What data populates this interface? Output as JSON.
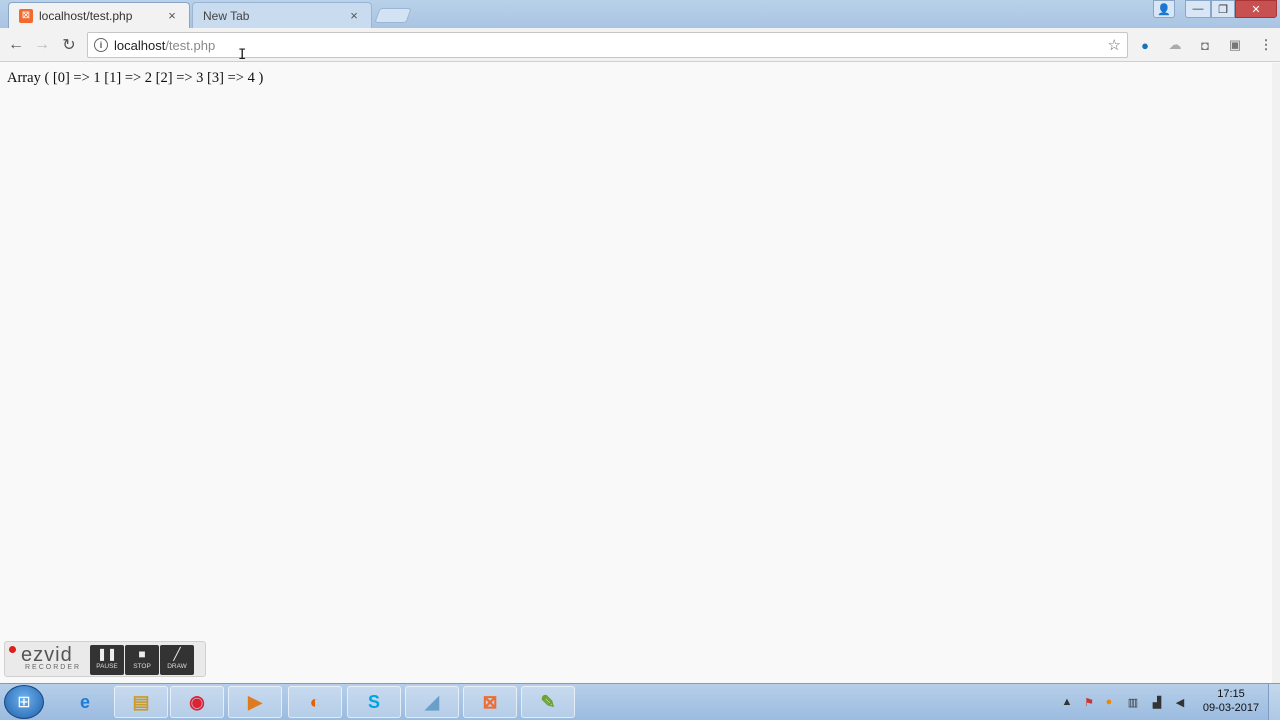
{
  "browser": {
    "tabs": [
      {
        "label": "localhost/test.php",
        "favicon": "xampp-icon",
        "active": true
      },
      {
        "label": "New Tab",
        "favicon": "",
        "active": false
      }
    ],
    "tab_close_glyph": "×",
    "address": {
      "host": "localhost",
      "path": "/test.php"
    },
    "nav": {
      "back": "←",
      "forward": "→",
      "reload": "↻"
    },
    "bookmark_star": "☆",
    "menu_glyph": "⋮",
    "window_controls": {
      "minimize": "—",
      "maximize": "❐",
      "close": "✕"
    }
  },
  "page": {
    "output_text": "Array ( [0] => 1 [1] => 2 [2] => 3 [3] => 4 )"
  },
  "ezvid": {
    "logo": "ezvid",
    "subtitle": "RECORDER",
    "buttons": [
      {
        "label": "PAUSE",
        "glyph": "❚❚"
      },
      {
        "label": "STOP",
        "glyph": "■"
      },
      {
        "label": "DRAW",
        "glyph": "╱"
      }
    ]
  },
  "taskbar": {
    "apps": [
      {
        "name": "internet-explorer",
        "glyph": "e"
      },
      {
        "name": "file-explorer",
        "glyph": "▤"
      },
      {
        "name": "chrome",
        "glyph": "◉"
      },
      {
        "name": "media-player",
        "glyph": "▶"
      },
      {
        "name": "firefox",
        "glyph": "◐"
      },
      {
        "name": "skype",
        "glyph": "S"
      },
      {
        "name": "tool",
        "glyph": "◢"
      },
      {
        "name": "xampp",
        "glyph": "⊠"
      },
      {
        "name": "notepad",
        "glyph": "✎"
      }
    ],
    "clock_time": "17:15",
    "clock_date": "09-03-2017"
  },
  "colors": {
    "accent": "#f26a2e",
    "taskbar": "#9bbbe0",
    "close_button": "#c75050"
  }
}
